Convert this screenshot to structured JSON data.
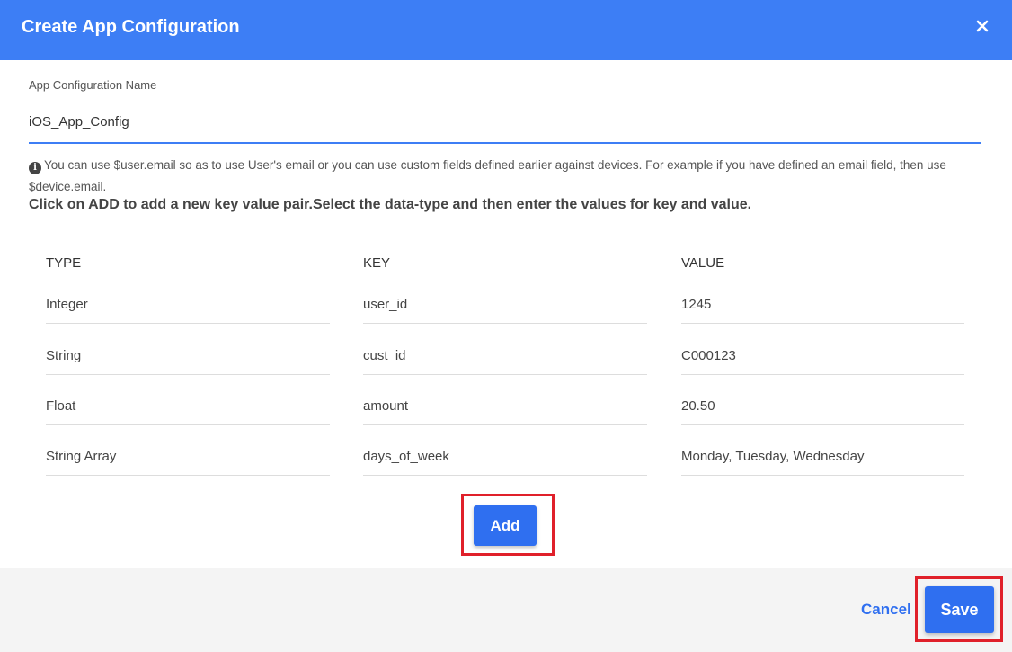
{
  "dialog": {
    "title": "Create App Configuration",
    "close_icon": "close-icon"
  },
  "form": {
    "name_label": "App Configuration Name",
    "name_value": "iOS_App_Config",
    "info_icon": "info-icon",
    "info_text": "You can use $user.email so as to use User's email or you can use custom fields defined earlier against devices. For example if you have defined an email field, then use $device.email.",
    "instruction": "Click on ADD to add a new key value pair.Select the data-type and then enter the values for key and value."
  },
  "table": {
    "headers": [
      "TYPE",
      "KEY",
      "VALUE"
    ],
    "rows": [
      {
        "type": "Integer",
        "key": "user_id",
        "value": "1245"
      },
      {
        "type": "String",
        "key": "cust_id",
        "value": "C000123"
      },
      {
        "type": "Float",
        "key": "amount",
        "value": "20.50"
      },
      {
        "type": "String Array",
        "key": "days_of_week",
        "value": "Monday, Tuesday, Wednesday"
      }
    ]
  },
  "actions": {
    "add_label": "Add",
    "cancel_label": "Cancel",
    "save_label": "Save"
  },
  "colors": {
    "header_bg": "#3d7ef5",
    "primary_button": "#2f6ff0",
    "highlight_border": "#e0202a",
    "footer_bg": "#f4f4f4"
  }
}
